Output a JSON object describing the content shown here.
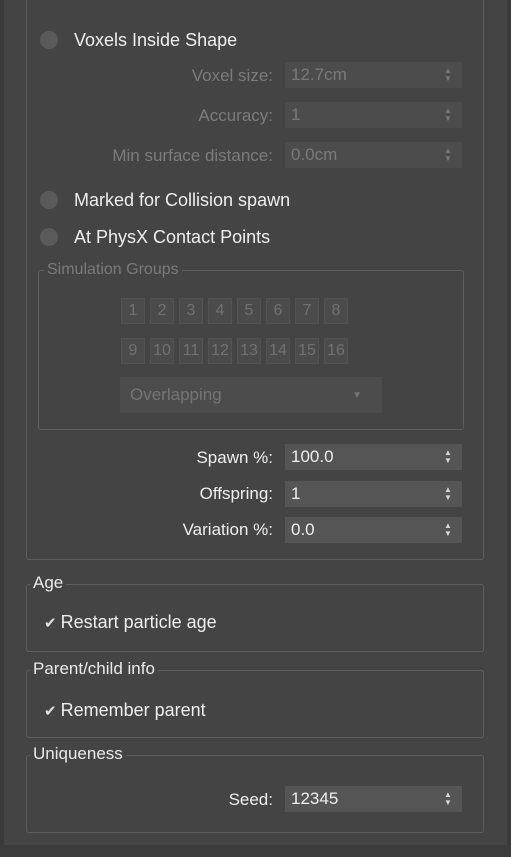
{
  "voxels": {
    "radio_label": "Voxels Inside Shape",
    "voxel_size_label": "Voxel size:",
    "voxel_size_value": "12.7cm",
    "accuracy_label": "Accuracy:",
    "accuracy_value": "1",
    "min_surface_label": "Min surface distance:",
    "min_surface_value": "0.0cm"
  },
  "collision_radio_label": "Marked for Collision spawn",
  "physx_radio_label": "At PhysX Contact Points",
  "simulation_groups": {
    "title": "Simulation Groups",
    "buttons": [
      "1",
      "2",
      "3",
      "4",
      "5",
      "6",
      "7",
      "8",
      "9",
      "10",
      "11",
      "12",
      "13",
      "14",
      "15",
      "16"
    ],
    "mode_selected": "Overlapping"
  },
  "spawn": {
    "spawn_label": "Spawn %:",
    "spawn_value": "100.0",
    "offspring_label": "Offspring:",
    "offspring_value": "1",
    "variation_label": "Variation %:",
    "variation_value": "0.0"
  },
  "age": {
    "title": "Age",
    "restart_label": "Restart particle age",
    "restart_checked": true
  },
  "parent_child": {
    "title": "Parent/child info",
    "remember_label": "Remember parent",
    "remember_checked": true
  },
  "uniqueness": {
    "title": "Uniqueness",
    "seed_label": "Seed:",
    "seed_value": "12345"
  },
  "icons": {
    "checkmark": "checkmark-icon",
    "spinner": "spinner-arrows-icon",
    "dropdown": "chevron-down-icon"
  }
}
